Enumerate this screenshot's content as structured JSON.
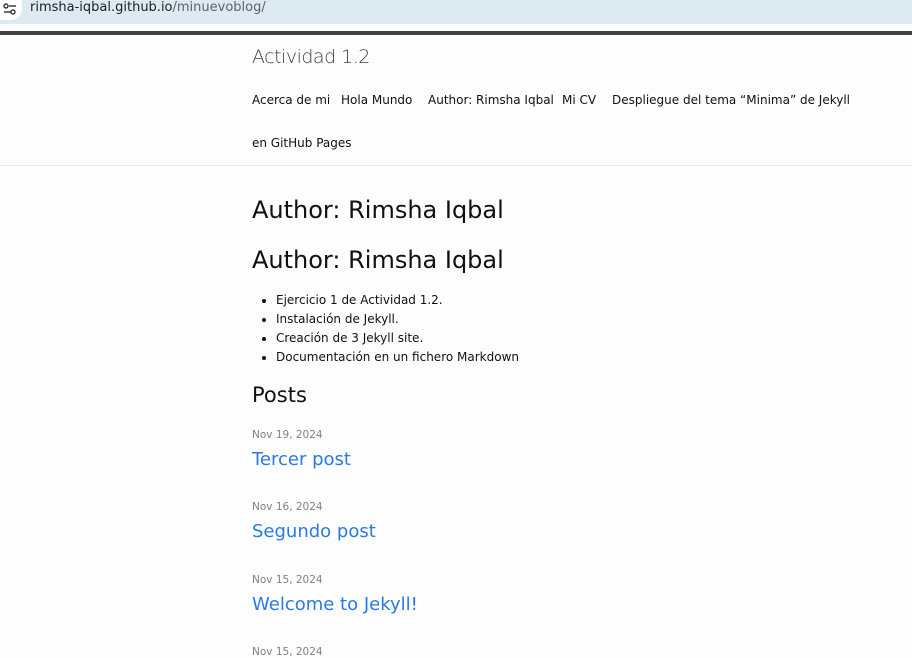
{
  "browser": {
    "url_host": "rimsha-iqbal.github.io",
    "url_path": "/minuevoblog/",
    "site_info_icon": "tune-icon"
  },
  "header": {
    "site_title": "Actividad 1.2",
    "nav": [
      "Acerca de mi",
      "Hola Mundo",
      "Author: Rimsha Iqbal",
      "Mi CV",
      "Despliegue del tema “Minima” de Jekyll",
      "en GitHub Pages"
    ]
  },
  "main": {
    "page_title": "Author: Rimsha Iqbal",
    "content_heading": "Author: Rimsha Iqbal",
    "list": [
      "Ejercicio 1 de Actividad 1.2.",
      "Instalación de Jekyll.",
      "Creación de 3 Jekyll site.",
      "Documentación en un fichero Markdown"
    ],
    "posts_heading": "Posts",
    "posts": [
      {
        "date": "Nov 19, 2024",
        "title": "Tercer post"
      },
      {
        "date": "Nov 16, 2024",
        "title": "Segundo post"
      },
      {
        "date": "Nov 15, 2024",
        "title": "Welcome to Jekyll!"
      },
      {
        "date": "Nov 15, 2024",
        "title": ""
      }
    ]
  },
  "colors": {
    "link": "#2a7ae2",
    "date": "#828282",
    "header_border": "#424242"
  }
}
